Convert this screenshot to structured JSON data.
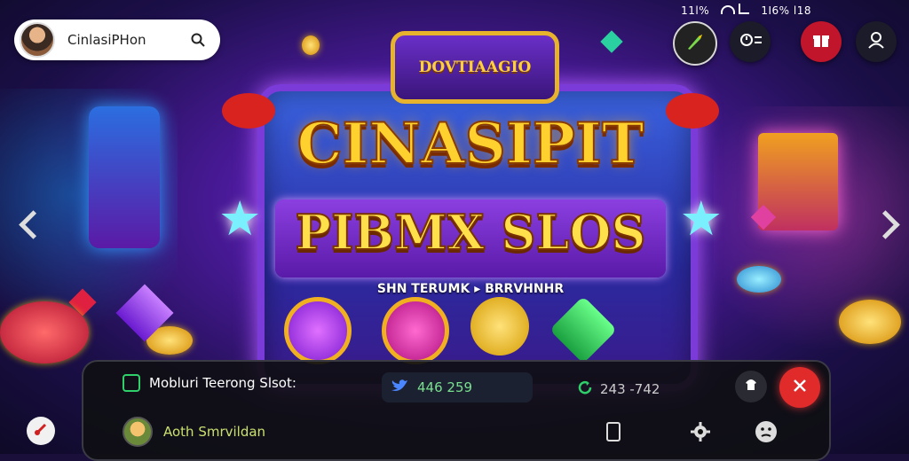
{
  "status_bar": {
    "left": "11l%",
    "right": "1I6%  l18"
  },
  "search": {
    "placeholder": "CinlasiPHon"
  },
  "banner": {
    "crest": "DOVTIAAGIO",
    "title_line1": "CINASIPIT",
    "title_line2": "PIBMX SLOS",
    "subtitle": "SHN TERUMK ▸ BRRVHNHR"
  },
  "bottom_bar": {
    "game_name": "Mobluri Teerong Slsot:",
    "twitter_count": "446 259",
    "cycle_count": "243 -742",
    "player_name": "Aoth Smrvildan"
  },
  "colors": {
    "accent_gold": "#ffd12e",
    "accent_purple": "#7a3bd8",
    "close_red": "#e12a2a"
  },
  "icons": [
    "search-icon",
    "brush-icon",
    "timer-icon",
    "gift-icon",
    "user-icon",
    "twitter-icon",
    "cycle-icon",
    "bookmark-icon",
    "settings-icon",
    "emoji-icon",
    "close-icon",
    "hat-icon",
    "guitar-icon"
  ]
}
